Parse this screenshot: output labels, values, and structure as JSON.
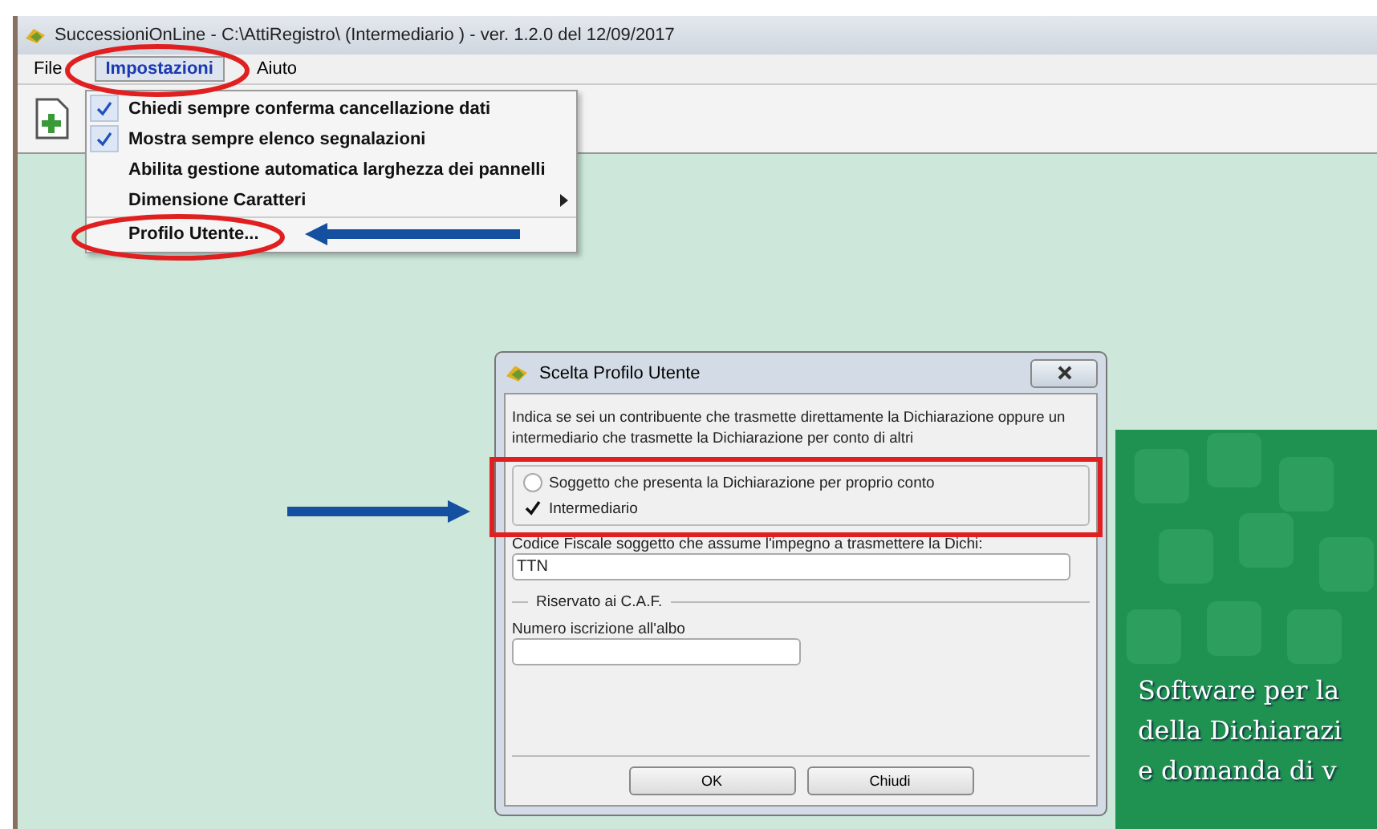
{
  "window": {
    "title": "SuccessioniOnLine - C:\\AttiRegistro\\ (Intermediario )  -  ver. 1.2.0 del 12/09/2017"
  },
  "menubar": [
    {
      "label": "File",
      "selected": false
    },
    {
      "label": "Impostazioni",
      "selected": true
    },
    {
      "label": "Aiuto",
      "selected": false
    }
  ],
  "menu": [
    {
      "label": "Chiedi sempre conferma cancellazione dati",
      "kind": "check",
      "checked": true
    },
    {
      "label": "Mostra sempre elenco segnalazioni",
      "kind": "check",
      "checked": true
    },
    {
      "label": "Abilita gestione automatica larghezza dei pannelli",
      "kind": "check",
      "checked": false
    },
    {
      "label": "Dimensione Caratteri",
      "kind": "submenu",
      "checked": false
    },
    {
      "label": "Profilo Utente...",
      "kind": "separated",
      "checked": false
    }
  ],
  "banner": {
    "lines": [
      "Software per la",
      "della Dichiarazi",
      "e domanda di v"
    ]
  },
  "dialog": {
    "title": "Scelta Profilo Utente",
    "intro": "Indica se sei un contribuente che trasmette direttamente la Dichiarazione oppure un intermediario che trasmette la Dichiarazione per conto di altri",
    "options": [
      {
        "label": "Soggetto che presenta la Dichiarazione per proprio conto",
        "selected": false
      },
      {
        "label": "Intermediario",
        "selected": true
      }
    ],
    "codice_label": "Codice Fiscale soggetto che assume l'impegno a trasmettere la Dichi:",
    "codice_value": "TTN",
    "group_title": "Riservato ai C.A.F.",
    "albo_label": "Numero iscrizione all'albo",
    "buttons": [
      "OK",
      "Chiudi"
    ]
  }
}
